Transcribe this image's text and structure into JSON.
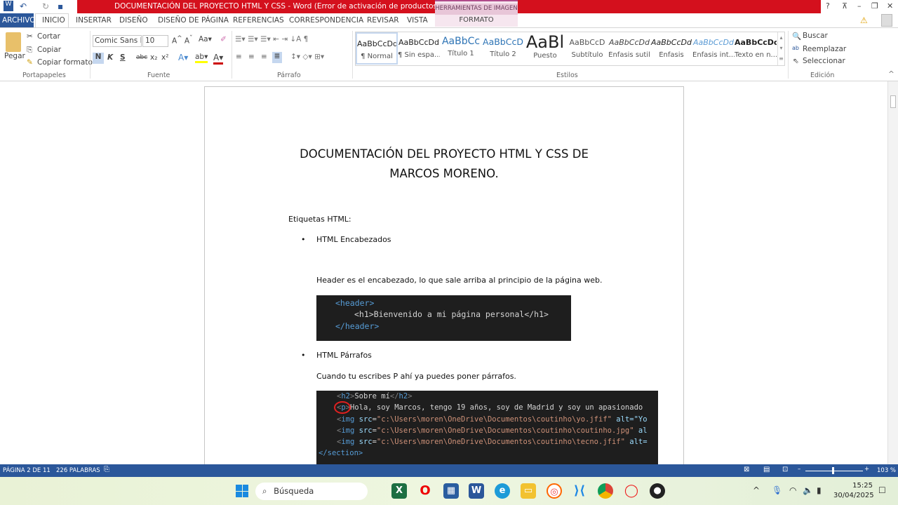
{
  "window": {
    "title": "DOCUMENTACIÓN DEL PROYECTO HTML Y CSS -  Word (Error de activación de productos)",
    "context_tab_group": "HERRAMIENTAS DE IMAGEN",
    "context_tab": "FORMATO",
    "help": "?",
    "minimize": "–",
    "restore": "❐",
    "close": "✕"
  },
  "tabs": [
    "ARCHIVO",
    "INICIO",
    "INSERTAR",
    "DISEÑO",
    "DISEÑO DE PÁGINA",
    "REFERENCIAS",
    "CORRESPONDENCIA",
    "REVISAR",
    "VISTA"
  ],
  "ribbon": {
    "portapapeles": {
      "label": "Portapapeles",
      "paste": "Pegar",
      "cut": "Cortar",
      "copy": "Copiar",
      "format_painter": "Copiar formato"
    },
    "fuente": {
      "label": "Fuente",
      "font": "Comic Sans M",
      "size": "10",
      "bold": "N",
      "italic": "K",
      "underline": "S",
      "strike": "abc",
      "sub": "x₂",
      "sup": "x²"
    },
    "parrafo": {
      "label": "Párrafo"
    },
    "estilos": {
      "label": "Estilos",
      "items": [
        {
          "preview": "AaBbCcDd",
          "name": "¶ Normal"
        },
        {
          "preview": "AaBbCcDd",
          "name": "¶ Sin espa..."
        },
        {
          "preview": "AaBbCc",
          "name": "Título 1"
        },
        {
          "preview": "AaBbCcD",
          "name": "Título 2"
        },
        {
          "preview": "AaBl",
          "name": "Puesto"
        },
        {
          "preview": "AaBbCcD",
          "name": "Subtítulo"
        },
        {
          "preview": "AaBbCcDd",
          "name": "Énfasis sutil"
        },
        {
          "preview": "AaBbCcDd",
          "name": "Énfasis"
        },
        {
          "preview": "AaBbCcDd",
          "name": "Énfasis int..."
        },
        {
          "preview": "AaBbCcDc",
          "name": "Texto en n..."
        }
      ]
    },
    "edicion": {
      "label": "Edición",
      "find": "Buscar",
      "replace": "Reemplazar",
      "select": "Seleccionar"
    }
  },
  "document": {
    "title_line1": "DOCUMENTACIÓN DEL PROYECTO HTML Y CSS DE",
    "title_line2": "MARCOS MORENO.",
    "section": "Etiquetas HTML:",
    "bullet1": "HTML Encabezados",
    "para1": "Header es el encabezado, lo que sale arriba al principio de la página web.",
    "code1": [
      "<header>",
      "<h1>Bienvenido a mi página personal</h1>",
      "</header>"
    ],
    "bullet2": "HTML Párrafos",
    "para2": "Cuando tu escribes P ahí ya puedes poner párrafos.",
    "code2": {
      "l1_text": "Sobre mí",
      "l2_text": "Hola, soy Marcos, tengo 19 años, soy de Madrid y soy un apasionado",
      "img_paths": [
        "\"c:\\Users\\moren\\OneDrive\\Documentos\\coutinho\\yo.jfif\"",
        "\"c:\\Users\\moren\\OneDrive\\Documentos\\coutinho\\coutinho.jpg\"",
        "\"c:\\Users\\moren\\OneDrive\\Documentos\\coutinho\\tecno.jfif\""
      ],
      "img_alt_tails": [
        "alt=\"Yo",
        "al",
        "alt="
      ],
      "close": "</section>"
    }
  },
  "status": {
    "page": "PÁGINA 2 DE 11",
    "words": "226 PALABRAS",
    "zoom": "103 %",
    "zoom_level_percent": 103
  },
  "taskbar": {
    "search": "Búsqueda",
    "time": "15:25",
    "date": "30/04/2025"
  },
  "colors": {
    "word_blue": "#2b579a",
    "title_red": "#d4101d",
    "code_bg": "#1e1e1e"
  }
}
